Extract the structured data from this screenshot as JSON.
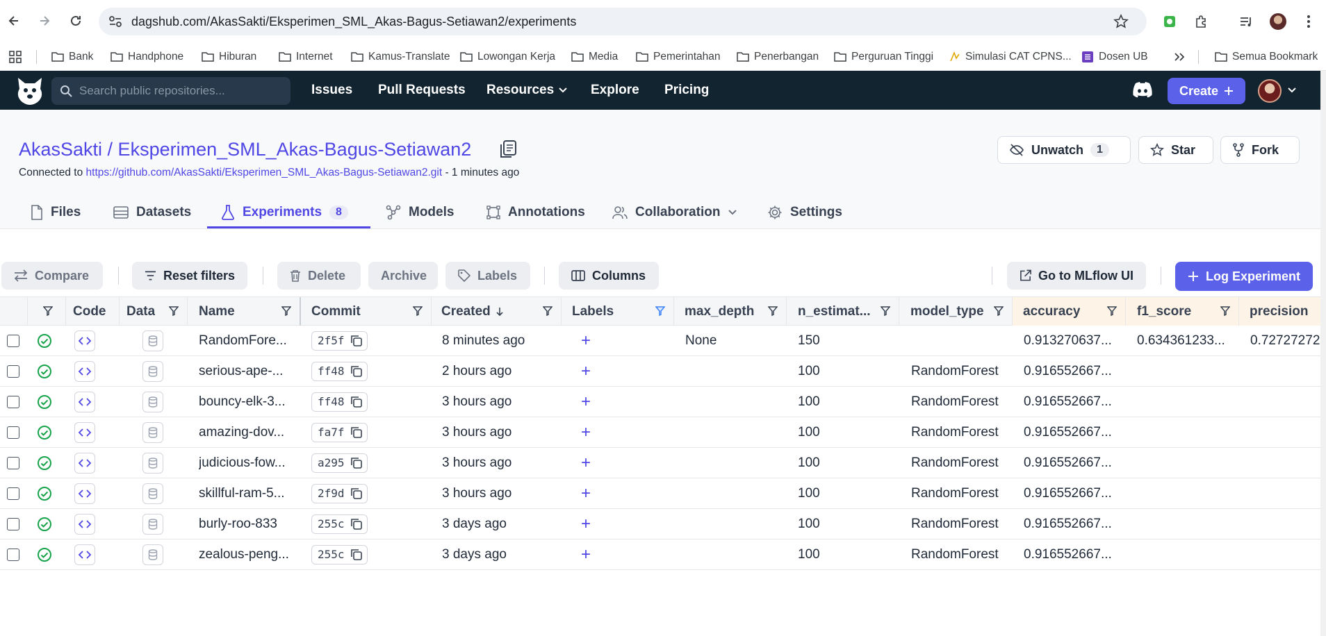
{
  "browser": {
    "url": "dagshub.com/AkasSakti/Eksperimen_SML_Akas-Bagus-Setiawan2/experiments",
    "bookmarks": [
      "Bank",
      "Handphone",
      "Hiburan",
      "Internet",
      "Kamus-Translate",
      "Lowongan Kerja",
      "Media",
      "Pemerintahan",
      "Penerbangan",
      "Perguruan Tinggi",
      "Simulasi CAT CPNS...",
      "Dosen UB",
      "Semua Bookmark"
    ]
  },
  "header": {
    "search_placeholder": "Search public repositories...",
    "nav": [
      "Issues",
      "Pull Requests",
      "Resources",
      "Explore",
      "Pricing"
    ],
    "create_label": "Create"
  },
  "repo": {
    "title": "AkasSakti / Eksperimen_SML_Akas-Bagus-Setiawan2",
    "connected_prefix": "Connected to",
    "connected_url": "https://github.com/AkasSakti/Eksperimen_SML_Akas-Bagus-Setiawan2.git",
    "connected_suffix": "- 1 minutes ago",
    "unwatch_label": "Unwatch",
    "unwatch_count": "1",
    "star_label": "Star",
    "fork_label": "Fork"
  },
  "tabs": [
    {
      "label": "Files"
    },
    {
      "label": "Datasets"
    },
    {
      "label": "Experiments",
      "badge": "8"
    },
    {
      "label": "Models"
    },
    {
      "label": "Annotations"
    },
    {
      "label": "Collaboration"
    },
    {
      "label": "Settings"
    }
  ],
  "toolbar": {
    "compare": "Compare",
    "reset_filters": "Reset filters",
    "delete": "Delete",
    "archive": "Archive",
    "labels": "Labels",
    "columns": "Columns",
    "mlflow": "Go to MLflow UI",
    "log_experiment": "Log Experiment"
  },
  "table": {
    "headers": {
      "code": "Code",
      "data": "Data",
      "name": "Name",
      "commit": "Commit",
      "created": "Created",
      "labels": "Labels",
      "max_depth": "max_depth",
      "n_estimators": "n_estimat...",
      "model_type": "model_type",
      "accuracy": "accuracy",
      "f1_score": "f1_score",
      "precision": "precision"
    },
    "rows": [
      {
        "name": "RandomFore...",
        "commit": "2f5f",
        "created": "8 minutes ago",
        "max_depth": "None",
        "n_estimators": "150",
        "model_type": "",
        "accuracy": "0.913270637...",
        "f1_score": "0.634361233...",
        "precision": "0.72727272"
      },
      {
        "name": "serious-ape-...",
        "commit": "ff48",
        "created": "2 hours ago",
        "max_depth": "",
        "n_estimators": "100",
        "model_type": "RandomForest",
        "accuracy": "0.916552667...",
        "f1_score": "",
        "precision": ""
      },
      {
        "name": "bouncy-elk-3...",
        "commit": "ff48",
        "created": "3 hours ago",
        "max_depth": "",
        "n_estimators": "100",
        "model_type": "RandomForest",
        "accuracy": "0.916552667...",
        "f1_score": "",
        "precision": ""
      },
      {
        "name": "amazing-dov...",
        "commit": "fa7f",
        "created": "3 hours ago",
        "max_depth": "",
        "n_estimators": "100",
        "model_type": "RandomForest",
        "accuracy": "0.916552667...",
        "f1_score": "",
        "precision": ""
      },
      {
        "name": "judicious-fow...",
        "commit": "a295",
        "created": "3 hours ago",
        "max_depth": "",
        "n_estimators": "100",
        "model_type": "RandomForest",
        "accuracy": "0.916552667...",
        "f1_score": "",
        "precision": ""
      },
      {
        "name": "skillful-ram-5...",
        "commit": "2f9d",
        "created": "3 hours ago",
        "max_depth": "",
        "n_estimators": "100",
        "model_type": "RandomForest",
        "accuracy": "0.916552667...",
        "f1_score": "",
        "precision": ""
      },
      {
        "name": "burly-roo-833",
        "commit": "255c",
        "created": "3 days ago",
        "max_depth": "",
        "n_estimators": "100",
        "model_type": "RandomForest",
        "accuracy": "0.916552667...",
        "f1_score": "",
        "precision": ""
      },
      {
        "name": "zealous-peng...",
        "commit": "255c",
        "created": "3 days ago",
        "max_depth": "",
        "n_estimators": "100",
        "model_type": "RandomForest",
        "accuracy": "0.916552667...",
        "f1_score": "",
        "precision": ""
      }
    ]
  },
  "colors": {
    "accent": "#4f46e5",
    "header_bg": "#112430",
    "success": "#16a34a",
    "metric_col_bg": "#fdf3e6"
  }
}
